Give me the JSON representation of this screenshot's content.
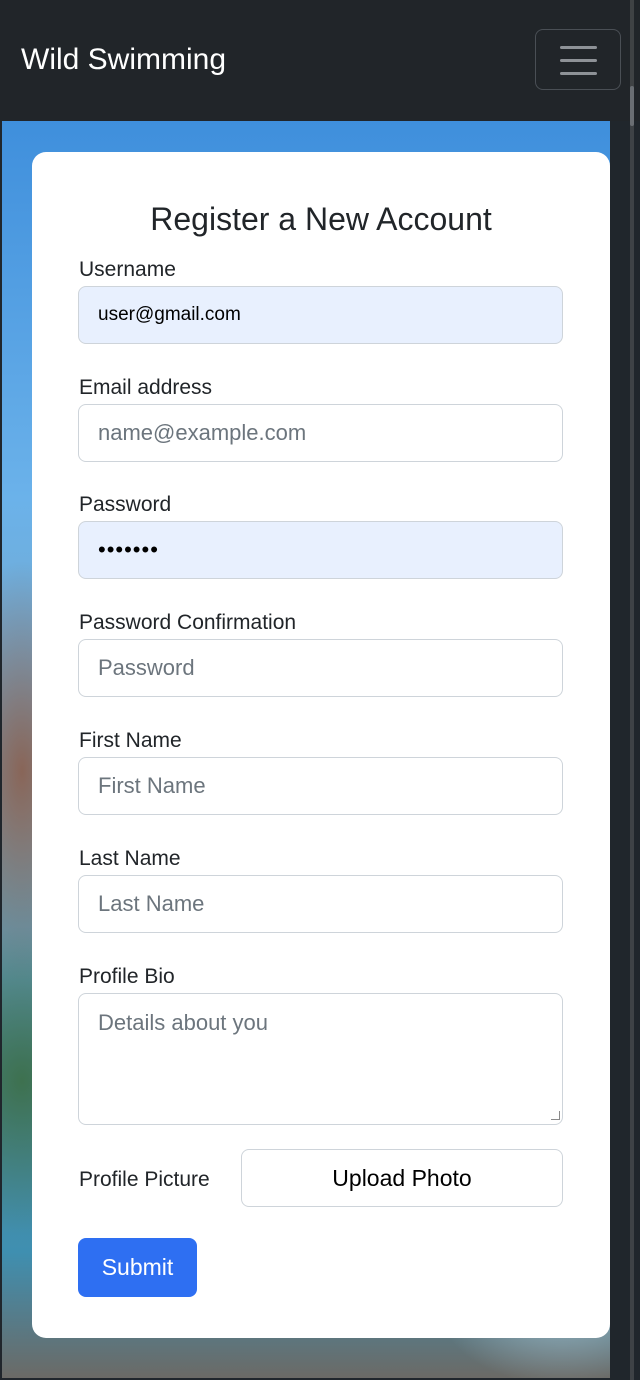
{
  "navbar": {
    "brand": "Wild Swimming"
  },
  "form": {
    "title": "Register a New Account",
    "username": {
      "label": "Username",
      "value": "user@gmail.com"
    },
    "email": {
      "label": "Email address",
      "placeholder": "name@example.com"
    },
    "password": {
      "label": "Password",
      "value": "•••••••"
    },
    "password_confirmation": {
      "label": "Password Confirmation",
      "placeholder": "Password"
    },
    "first_name": {
      "label": "First Name",
      "placeholder": "First Name"
    },
    "last_name": {
      "label": "Last Name",
      "placeholder": "Last Name"
    },
    "profile_bio": {
      "label": "Profile Bio",
      "placeholder": "Details about you"
    },
    "profile_picture": {
      "label": "Profile Picture",
      "button": "Upload Photo"
    },
    "submit_label": "Submit"
  },
  "colors": {
    "navbar": "#212529",
    "primary": "#2e6ff2",
    "autofill": "#e8f0fe"
  }
}
